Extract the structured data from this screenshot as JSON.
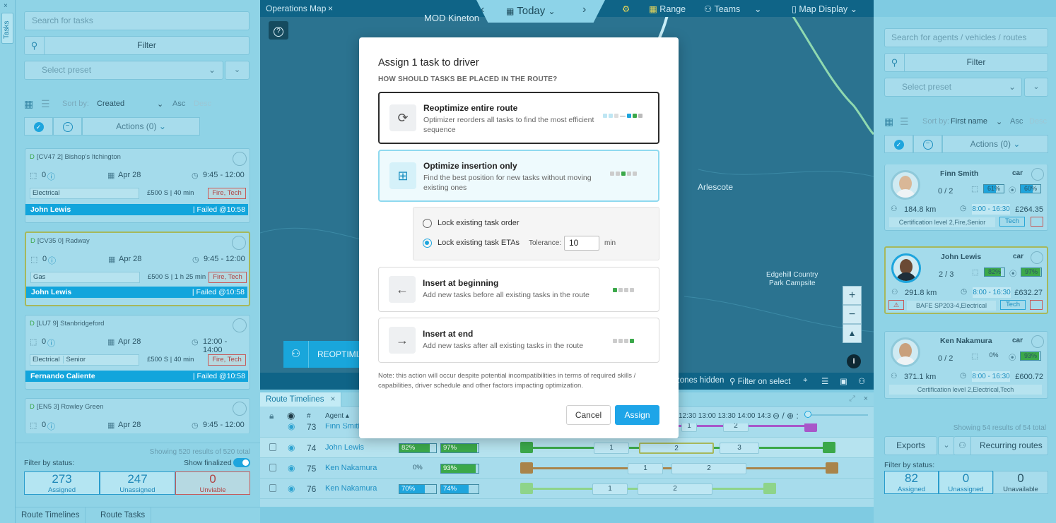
{
  "left_rail": {
    "close": "×",
    "tab_label": "Tasks"
  },
  "tasks_panel": {
    "search_placeholder": "Search for tasks",
    "filter_label": "Filter",
    "preset_placeholder": "Select preset",
    "sort_label": "Sort by:",
    "sort_value": "Created",
    "asc": "Asc",
    "desc": "Desc",
    "actions_label": "Actions (0)",
    "cards": [
      {
        "prefix": "D",
        "title": "[CV47 2] Bishop's Itchington",
        "count": "0",
        "date": "Apr 28",
        "time": "9:45 - 12:00",
        "skills": "Electrical",
        "price": "£500 S | 40 min",
        "tag": "Fire, Tech",
        "assignee": "John Lewis",
        "status": "| Failed @10:58"
      },
      {
        "prefix": "D",
        "title": "[CV35 0] Radway",
        "count": "0",
        "date": "Apr 28",
        "time": "9:45 - 12:00",
        "skills": "Gas",
        "price": "£500 S | 1 h 25 min",
        "tag": "Fire, Tech",
        "assignee": "John Lewis",
        "status": "| Failed @10:58"
      },
      {
        "prefix": "D",
        "title": "[LU7 9] Stanbridgeford",
        "count": "0",
        "date": "Apr 28",
        "time": "12:00 - 14:00",
        "skills": "Electrical",
        "skills2": "Senior",
        "price": "£500 S | 40 min",
        "tag": "Fire, Tech",
        "assignee": "Fernando Caliente",
        "status": "| Failed @10:58"
      },
      {
        "prefix": "D",
        "title": "[EN5 3] Rowley Green",
        "count": "0",
        "date": "Apr 28",
        "time": "9:45 - 12:00"
      }
    ],
    "footer": {
      "showing": "Showing 520 results of 520 total",
      "filter_by_status": "Filter by status:",
      "show_finalized": "Show finalized",
      "assigned": {
        "value": "273",
        "label": "Assigned"
      },
      "unassigned": {
        "value": "247",
        "label": "Unassigned"
      },
      "unviable": {
        "value": "0",
        "label": "Unviable"
      }
    }
  },
  "bottom_tabs": [
    "Route Timelines",
    "Route Tasks"
  ],
  "map": {
    "tab_title": "Operations Map",
    "tab_close": "×",
    "date_label": "Today",
    "range_label": "Range",
    "teams_label": "Teams",
    "map_display_label": "Map Display",
    "labels": {
      "kineton": "MOD Kineton",
      "arlescote": "Arlescote",
      "edgehill1": "Edgehill Country",
      "edgehill2": "Park Campsite"
    },
    "reoptimize_label": "REOPTIMIZE",
    "zones_hidden": "zones hidden",
    "filter_on_select": "Filter on select",
    "help": "?",
    "info": "i"
  },
  "timelines": {
    "tab_title": "Route Timelines",
    "tab_close": "×",
    "col_hash": "#",
    "col_agent": "Agent ▴",
    "times": "12:30 13:00 13:30 14:00 14:3",
    "rows": [
      {
        "num": "73",
        "agent": "Finn Smith"
      },
      {
        "num": "74",
        "agent": "John Lewis",
        "m1": "82%",
        "m2": "97%",
        "seg1": "1",
        "seg2": "2",
        "seg3": "3"
      },
      {
        "num": "75",
        "agent": "Ken Nakamura",
        "m1": "0%",
        "m2": "93%",
        "seg1": "1",
        "seg2": "2"
      },
      {
        "num": "76",
        "agent": "Ken Nakamura",
        "m1": "70%",
        "m2": "74%",
        "seg1": "1",
        "seg2": "2"
      }
    ],
    "row73_segs": [
      "1",
      "2"
    ]
  },
  "agents_panel": {
    "search_placeholder": "Search for agents / vehicles / routes",
    "filter_label": "Filter",
    "preset_placeholder": "Select preset",
    "sort_label": "Sort by:",
    "sort_value": "First name",
    "asc": "Asc",
    "desc": "Desc",
    "actions_label": "Actions (0)",
    "cards": [
      {
        "name": "Finn Smith",
        "vehicle": "car",
        "tasks": "0 / 2",
        "m1": "61%",
        "m2": "60%",
        "km": "184.8 km",
        "hours": "8:00 - 16:30",
        "cost": "£264.35",
        "skills": "Certification level 2,Fire,Senior",
        "tag": "Tech"
      },
      {
        "name": "John Lewis",
        "vehicle": "car",
        "tasks": "2 / 3",
        "m1": "82%",
        "m2": "97%",
        "km": "291.8 km",
        "hours": "8:00 - 16:30",
        "cost": "£632.27",
        "skills": "BAFE SP203-4,Electrical",
        "tag": "Tech"
      },
      {
        "name": "Ken Nakamura",
        "vehicle": "car",
        "tasks": "0 / 2",
        "m1": "0%",
        "m2": "93%",
        "km": "371.1 km",
        "hours": "8:00 - 16:30",
        "cost": "£600.72",
        "skills": "Certification level 2,Electrical,Tech"
      }
    ],
    "footer": {
      "showing": "Showing 54 results of 54 total",
      "exports": "Exports",
      "recurring": "Recurring routes",
      "filter_by_status": "Filter by status:",
      "assigned": {
        "value": "82",
        "label": "Assigned"
      },
      "unassigned": {
        "value": "0",
        "label": "Unassigned"
      },
      "unavailable": {
        "value": "0",
        "label": "Unavailable"
      }
    }
  },
  "modal": {
    "title": "Assign 1 task to driver",
    "subtitle": "HOW SHOULD TASKS BE PLACED IN THE ROUTE?",
    "options": [
      {
        "title": "Reoptimize entire route",
        "desc": "Optimizer reorders all tasks to find the most efficient sequence"
      },
      {
        "title": "Optimize insertion only",
        "desc": "Find the best position for new tasks without moving existing ones"
      },
      {
        "title": "Insert at beginning",
        "desc": "Add new tasks before all existing tasks in the route"
      },
      {
        "title": "Insert at end",
        "desc": "Add new tasks after all existing tasks in the route"
      }
    ],
    "lock_order": "Lock existing task order",
    "lock_etas": "Lock existing task ETAs",
    "tolerance_label": "Tolerance:",
    "tolerance_value": "10",
    "tolerance_unit": "min",
    "note": "Note: this action will occur despite potential incompatibilities in terms of required skills / capabilities, driver schedule and other factors impacting optimization.",
    "cancel": "Cancel",
    "assign": "Assign"
  },
  "colors": {
    "accent": "#1ea5e8",
    "panel": "#8fd3e6",
    "map": "#2b7390",
    "success": "#3aa64a",
    "danger": "#c65a5a"
  }
}
